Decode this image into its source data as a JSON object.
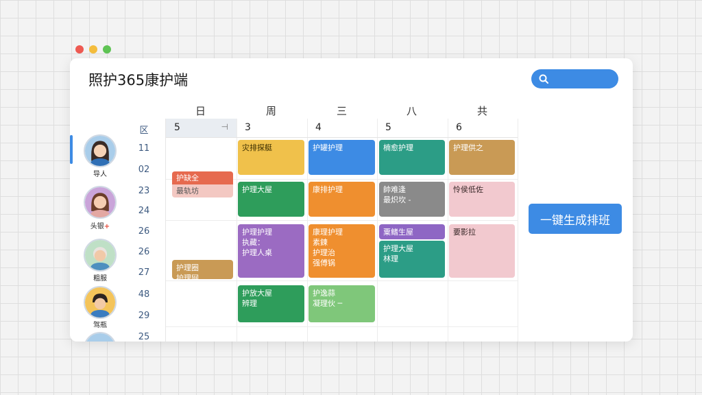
{
  "app": {
    "title": "照护365康护端"
  },
  "search": {
    "icon": "search-icon"
  },
  "calendar": {
    "day_headers": [
      "日",
      "周",
      "三",
      "八",
      "共"
    ],
    "dates": [
      "5",
      "3",
      "4",
      "5",
      "6"
    ],
    "first_date_arrow": "⊣",
    "time_header": "区",
    "times": [
      "11",
      "02",
      "23",
      "24",
      "26",
      "26",
      "27",
      "48",
      "29",
      "25"
    ]
  },
  "staff": [
    {
      "name": "导人",
      "badge": ""
    },
    {
      "name": "头银",
      "badge": "+"
    },
    {
      "name": "粗服",
      "badge": ""
    },
    {
      "name": "驾瓶",
      "badge": ""
    }
  ],
  "events": [
    {
      "lines": [
        "护缺全",
        "最轨坊"
      ],
      "color": "#e66a4f",
      "color2": "#f3c8c2"
    },
    {
      "lines": [
        "护理圈",
        "护理网"
      ],
      "color": "#c99a55"
    },
    {
      "lines": [
        "灾排探艇"
      ],
      "color": "#f0c14b"
    },
    {
      "lines": [
        "护理大屋"
      ],
      "color": "#2e9d5b"
    },
    {
      "lines": [
        "护理护理",
        "执藏：",
        "",
        "护理人桌"
      ],
      "color": "#9b6bc2"
    },
    {
      "lines": [
        "护放大屋",
        "辨理"
      ],
      "color": "#2e9d5b"
    },
    {
      "lines": [
        "护罐护理"
      ],
      "color": "#3d8be4"
    },
    {
      "lines": [
        "康排护理"
      ],
      "color": "#ef8f2f"
    },
    {
      "lines": [
        "康理护理",
        "素鍊",
        "护理治",
        "强傅锅"
      ],
      "color": "#ef8f2f"
    },
    {
      "lines": [
        "护逸蒜",
        "凝理伙 ─"
      ],
      "color": "#7fc77a"
    },
    {
      "lines": [
        "楠愈护理"
      ],
      "color": "#2c9d86"
    },
    {
      "lines": [
        "帥难逢",
        "最炽坎 -"
      ],
      "color": "#8a8a8a"
    },
    {
      "lines": [
        "粟鳍生屋"
      ],
      "color": "#8e66c4"
    },
    {
      "lines": [
        "护理大屋",
        "林理"
      ],
      "color": "#2c9d86"
    },
    {
      "lines": [
        "护理供之"
      ],
      "color": "#c99a55"
    },
    {
      "lines": [
        "怜侯低佐"
      ],
      "color": "#f2c9cf",
      "dark": true
    },
    {
      "lines": [
        "要影拉"
      ],
      "color": "#f2c9cf",
      "dark": true
    }
  ],
  "actions": {
    "auto_schedule": "一键生成排班"
  }
}
